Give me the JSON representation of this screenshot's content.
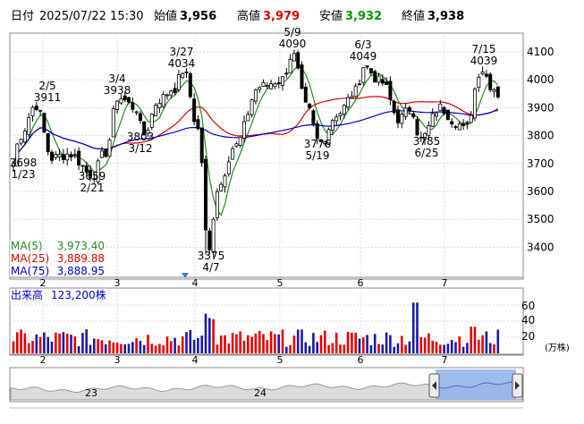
{
  "header": {
    "date_label": "日付",
    "datetime": "2025/07/22 15:30",
    "open_label": "始値",
    "open_value": "3,956",
    "high_label": "高値",
    "high_value": "3,979",
    "low_label": "安値",
    "low_value": "3,932",
    "close_label": "終値",
    "close_value": "3,938"
  },
  "colors": {
    "up_candle": "#ffffff",
    "down_candle": "#000000",
    "ma5": "#228b22",
    "ma25": "#dd0000",
    "ma75": "#0000cc",
    "volume_up": "#e60000",
    "volume_down": "#1a1aa6",
    "high_value_color": "#dd0000",
    "low_value_color": "#009900"
  },
  "legend": [
    {
      "name": "MA(5)",
      "value": "3,973.40",
      "color": "#228b22"
    },
    {
      "name": "MA(25)",
      "value": "3,889.88",
      "color": "#dd0000"
    },
    {
      "name": "MA(75)",
      "value": "3,888.95",
      "color": "#0000cc"
    }
  ],
  "volume": {
    "label": "出来高",
    "value": "123,200株",
    "unit": "(万株)",
    "ticks": [
      "60",
      "40",
      "20"
    ]
  },
  "navigator": {
    "labels": [
      "23",
      "24"
    ]
  },
  "chart_data": {
    "type": "candlestick",
    "price_ylim": [
      3300,
      4150
    ],
    "price_ticks": [
      "4100",
      "4000",
      "3900",
      "3800",
      "3700",
      "3600",
      "3500",
      "3400"
    ],
    "x_month_labels": [
      "2",
      "3",
      "4",
      "5",
      "6",
      "7"
    ],
    "volume_ylim": [
      0,
      70
    ],
    "annotations": [
      {
        "price": "3698",
        "date": "1/23"
      },
      {
        "price": "3911",
        "date": "2/5"
      },
      {
        "price": "3659",
        "date": "2/21"
      },
      {
        "price": "3938",
        "date": "3/4"
      },
      {
        "price": "3803",
        "date": "3/12"
      },
      {
        "price": "4034",
        "date": "3/27"
      },
      {
        "price": "3375",
        "date": "4/7"
      },
      {
        "price": "4090",
        "date": "5/9"
      },
      {
        "price": "3776",
        "date": "5/19"
      },
      {
        "price": "4049",
        "date": "6/3"
      },
      {
        "price": "3785",
        "date": "6/25"
      },
      {
        "price": "4039",
        "date": "7/15"
      }
    ]
  }
}
